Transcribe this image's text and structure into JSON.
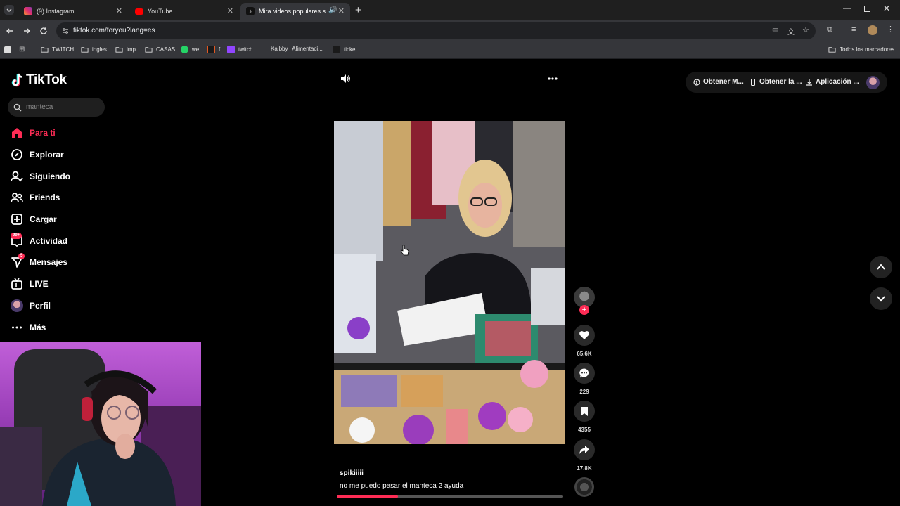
{
  "browser": {
    "tabs": [
      {
        "title": "(9) Instagram",
        "active": false,
        "icon": "instagram-icon",
        "color": "#e1306c"
      },
      {
        "title": "YouTube",
        "active": false,
        "icon": "youtube-icon",
        "color": "#ff0000"
      },
      {
        "title": "Mira videos populares sele",
        "active": true,
        "icon": "tiktok-icon",
        "color": "#111111"
      }
    ],
    "url": "tiktok.com/foryou?lang=es",
    "bookmarks": [
      {
        "label": "TWITCH",
        "icon": "folder-icon"
      },
      {
        "label": "ingles",
        "icon": "folder-icon"
      },
      {
        "label": "imp",
        "icon": "folder-icon"
      },
      {
        "label": "CASAS",
        "icon": "folder-icon"
      },
      {
        "label": "we",
        "icon": "whatsapp-icon"
      },
      {
        "label": "f",
        "icon": "bookmark-site-icon"
      },
      {
        "label": "twitch",
        "icon": "twitch-icon"
      },
      {
        "label": "Kaibby l Alimentaci...",
        "icon": "site-icon"
      },
      {
        "label": "ticket",
        "icon": "bookmark-site-icon"
      }
    ],
    "all_bookmarks": "Todos los marcadores"
  },
  "tiktok": {
    "logo": "TikTok",
    "search_placeholder": "manteca",
    "nav": [
      {
        "label": "Para ti",
        "icon": "home-icon",
        "active": true
      },
      {
        "label": "Explorar",
        "icon": "compass-icon"
      },
      {
        "label": "Siguiendo",
        "icon": "following-icon"
      },
      {
        "label": "Friends",
        "icon": "friends-icon"
      },
      {
        "label": "Cargar",
        "icon": "upload-icon"
      },
      {
        "label": "Actividad",
        "icon": "activity-icon",
        "badge": "99+"
      },
      {
        "label": "Mensajes",
        "icon": "messages-icon",
        "badge": "5"
      },
      {
        "label": "LIVE",
        "icon": "live-icon"
      },
      {
        "label": "Perfil",
        "icon": "profile-avatar"
      },
      {
        "label": "Más",
        "icon": "more-icon"
      }
    ],
    "top_buttons": [
      {
        "label": "Obtener M...",
        "icon": "coin-icon"
      },
      {
        "label": "Obtener la ...",
        "icon": "phone-icon"
      },
      {
        "label": "Aplicación ...",
        "icon": "download-icon"
      }
    ],
    "video": {
      "author": "spikiiiii",
      "caption": "no me puedo pasar el manteca 2 ayuda",
      "progress": 0.27
    },
    "actions": {
      "likes": "65.6K",
      "comments": "229",
      "saves": "4355",
      "shares": "17.8K"
    }
  },
  "colors": {
    "accent": "#fe2c55",
    "chrome_bg": "#35363a",
    "tab_bg": "#1f1f1f"
  }
}
